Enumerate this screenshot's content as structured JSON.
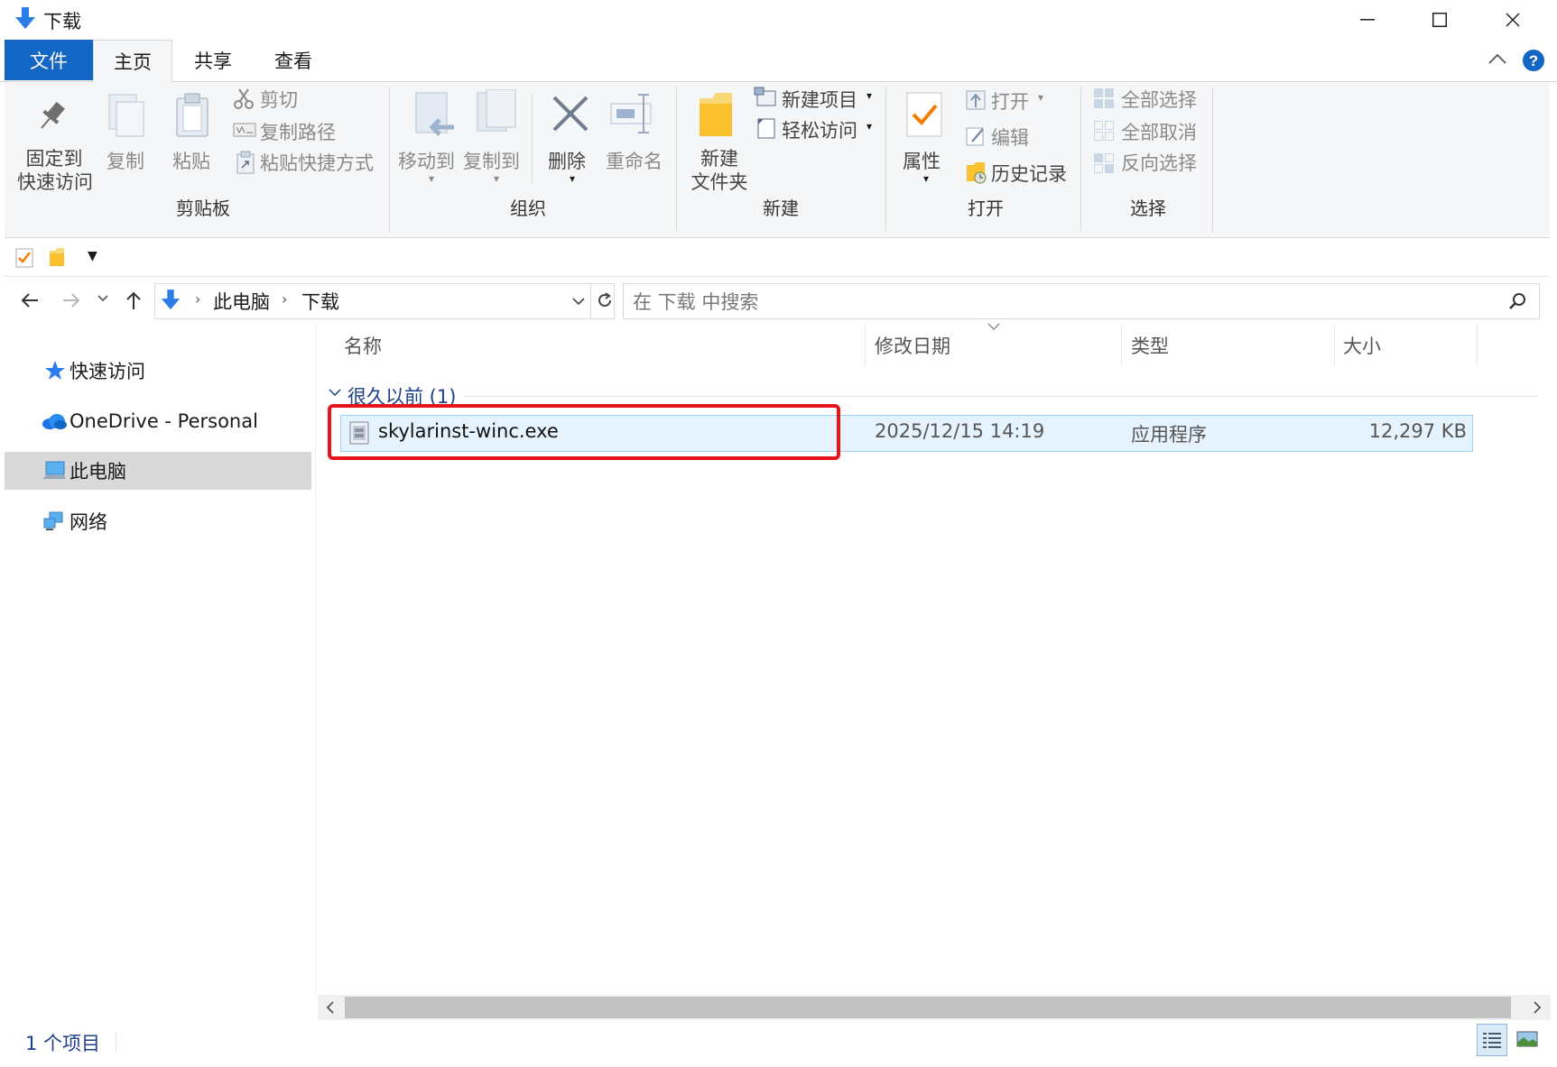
{
  "window": {
    "title": "下载"
  },
  "tabs": [
    {
      "label": "文件"
    },
    {
      "label": "主页"
    },
    {
      "label": "共享"
    },
    {
      "label": "查看"
    }
  ],
  "ribbon": {
    "clipboard": {
      "pin_line1": "固定到",
      "pin_line2": "快速访问",
      "copy": "复制",
      "paste": "粘贴",
      "cut": "剪切",
      "copy_path": "复制路径",
      "paste_shortcut": "粘贴快捷方式",
      "group": "剪贴板"
    },
    "organize": {
      "move_to": "移动到",
      "copy_to": "复制到",
      "delete": "删除",
      "rename": "重命名",
      "group": "组织"
    },
    "new": {
      "new_folder_line1": "新建",
      "new_folder_line2": "文件夹",
      "new_item": "新建项目",
      "easy_access": "轻松访问",
      "group": "新建"
    },
    "open": {
      "properties": "属性",
      "open": "打开",
      "edit": "编辑",
      "history": "历史记录",
      "group": "打开"
    },
    "select": {
      "select_all": "全部选择",
      "select_none": "全部取消",
      "invert": "反向选择",
      "group": "选择"
    }
  },
  "address": {
    "crumbs": [
      "此电脑",
      "下载"
    ],
    "search_placeholder": "在 下载 中搜索"
  },
  "nav": {
    "items": [
      {
        "label": "快速访问"
      },
      {
        "label": "OneDrive - Personal"
      },
      {
        "label": "此电脑"
      },
      {
        "label": "网络"
      }
    ]
  },
  "columns": [
    "名称",
    "修改日期",
    "类型",
    "大小"
  ],
  "group_header": "很久以前 (1)",
  "files": [
    {
      "name": "skylarinst-winc.exe",
      "modified": "2025/12/15 14:19",
      "type": "应用程序",
      "size": "12,297 KB"
    }
  ],
  "status": {
    "count": "1 个项目"
  },
  "colors": {
    "accent": "#1366c3",
    "highlight_box": "#e8141c",
    "selection": "#e5f3ff"
  }
}
